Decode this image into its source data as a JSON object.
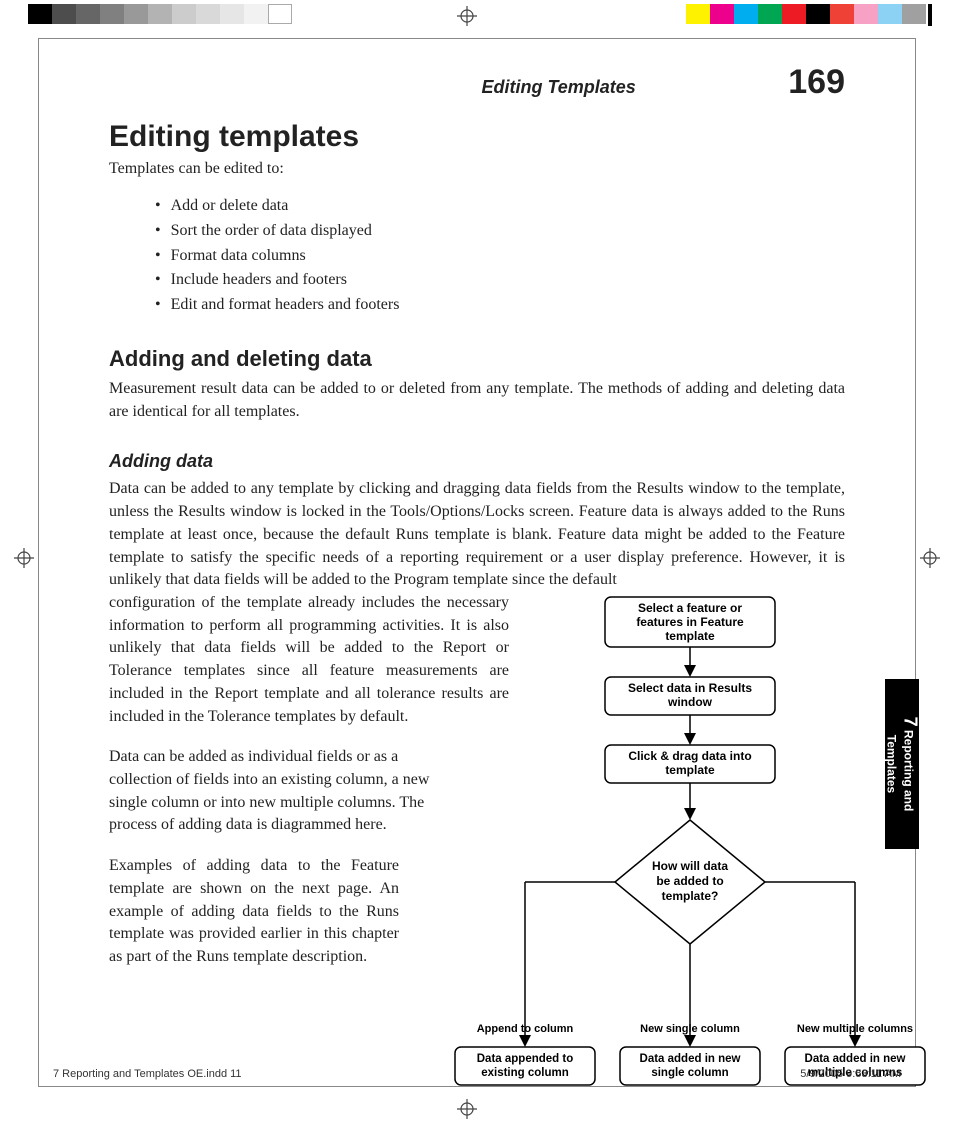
{
  "colorbar": {
    "left": [
      "#000000",
      "#4d4d4d",
      "#666666",
      "#808080",
      "#999999",
      "#b3b3b3",
      "#cccccc",
      "#d9d9d9",
      "#e6e6e6",
      "#f2f2f2",
      "#ffffff"
    ],
    "right": [
      "#fff200",
      "#ec008c",
      "#00aeef",
      "#00a651",
      "#ed1c24",
      "#000000",
      "#ef4136",
      "#f7a1c4",
      "#8cd2f4",
      "#a0a0a0"
    ]
  },
  "header": {
    "running": "Editing Templates",
    "page": "169"
  },
  "h1": "Editing templates",
  "intro": "Templates can be edited to:",
  "bullets": [
    "Add or delete data",
    "Sort the order of data displayed",
    "Format data columns",
    "Include headers and footers",
    "Edit and format headers and footers"
  ],
  "h2": "Adding and deleting data",
  "p_h2": "Measurement result data can be added to or deleted from any template.  The methods of adding and deleting data are identical for all templates.",
  "h3": "Adding data",
  "p_full": "Data can be added to any template by clicking and dragging data fields from the Results window to the template, unless the Results window is locked in the Tools/Options/Locks screen. Feature data is always added to the Runs template at least once, because the default Runs template is blank.  Feature data might be added to the Feature template to satisfy the specific needs of a reporting requirement or a user display preference.  However, it is unlikely that data fields will be added to the Program template since the default",
  "col": {
    "p1": "configuration of the template already includes the necessary information to perform all programming activities. It is also unlikely that data fields will be added to the Report or Tolerance templates since all feature measurements are included in the Report template and all tolerance results are included in the Tolerance templates by default.",
    "p2": "Data can be added as individual fields or as a collection of fields into an existing column, a new single column or into new multiple columns.  The process of adding data is diagrammed here.",
    "p3": "Examples of adding data to the Feature template are shown on the next page. An example of adding data fields to the Runs template was provided earlier in this chapter as part of the Runs template description."
  },
  "flow": {
    "b1a": "Select a feature or",
    "b1b": "features in Feature",
    "b1c": "template",
    "b2a": "Select data in Results",
    "b2b": "window",
    "b3a": "Click & drag data into",
    "b3b": "template",
    "d1": "How will data",
    "d2": "be added to",
    "d3": "template?",
    "l1": "Append to column",
    "l2": "New single column",
    "l3": "New multiple columns",
    "r1a": "Data appended to",
    "r1b": "existing column",
    "r2a": "Data added in new",
    "r2b": "single column",
    "r3a": "Data added in new",
    "r3b": "multiple columns"
  },
  "sidetab": {
    "num": "7",
    "line1": "Reporting and",
    "line2": "Templates"
  },
  "footer": {
    "left": "7 Reporting and Templates OE.indd   11",
    "right": "5/9/2005   9:53:11 AM"
  }
}
